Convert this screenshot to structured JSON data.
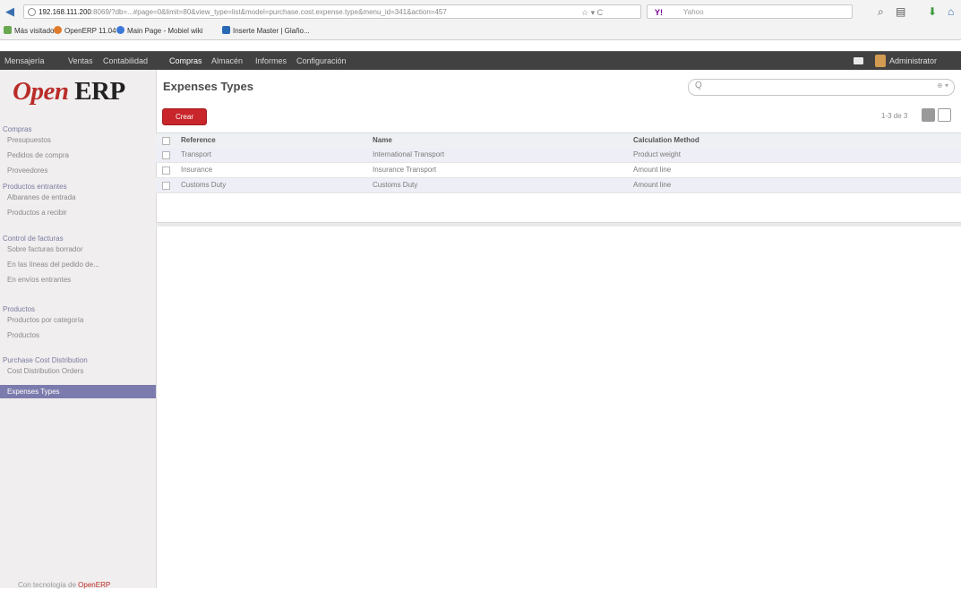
{
  "browser": {
    "url_host": "192.168.111.200",
    "url_path": ":8069/?db=...#page=0&limit=80&view_type=list&model=purchase.cost.expense.type&menu_id=341&action=457",
    "search_placeholder": "Yahoo",
    "search_engine": "Y!",
    "bookmarks": [
      {
        "label": "Más visitados",
        "color": "#6aa84f"
      },
      {
        "label": "OpenERP 11.04",
        "color": "#e07b2a"
      },
      {
        "label": "Main Page - Mobiel wiki",
        "color": "#3c78d8"
      },
      {
        "label": "Inserte Master | Glaño...",
        "color": "#2a6ab5"
      }
    ]
  },
  "topmenu": {
    "items": [
      "Mensajería",
      "Ventas",
      "Contabilidad",
      "Compras",
      "Almacén",
      "Informes",
      "Configuración"
    ],
    "active": "Compras",
    "user": "Administrator"
  },
  "logo": {
    "open": "Open",
    "erp": "ERP"
  },
  "sidebar": {
    "groups": [
      {
        "label": "Compras",
        "items": [
          "Presupuestos",
          "Pedidos de compra",
          "Proveedores"
        ]
      },
      {
        "label": "Productos entrantes",
        "items": [
          "Albaranes de entrada",
          "Productos a recibir"
        ]
      },
      {
        "label": "Control de facturas",
        "items": [
          "Sobre facturas borrador",
          "En las líneas del pedido de...",
          "En envíos entrantes"
        ]
      },
      {
        "label": "Productos",
        "items": [
          "Productos por categoría",
          "Productos"
        ]
      },
      {
        "label": "Purchase Cost Distribution",
        "items": [
          "Cost Distribution Orders",
          "Expenses Types"
        ]
      }
    ],
    "active_item": "Expenses Types",
    "powered_prefix": "Con tecnología de",
    "powered_brand": "OpenERP"
  },
  "main": {
    "title": "Expenses Types",
    "search_icon": "Q",
    "create_label": "Crear",
    "pager": "1-3 de 3",
    "columns": [
      "Reference",
      "Name",
      "Calculation Method"
    ],
    "rows": [
      {
        "reference": "Transport",
        "name": "International Transport",
        "method": "Product weight"
      },
      {
        "reference": "Insurance",
        "name": "Insurance Transport",
        "method": "Amount line"
      },
      {
        "reference": "Customs Duty",
        "name": "Customs Duty",
        "method": "Amount line"
      }
    ]
  }
}
